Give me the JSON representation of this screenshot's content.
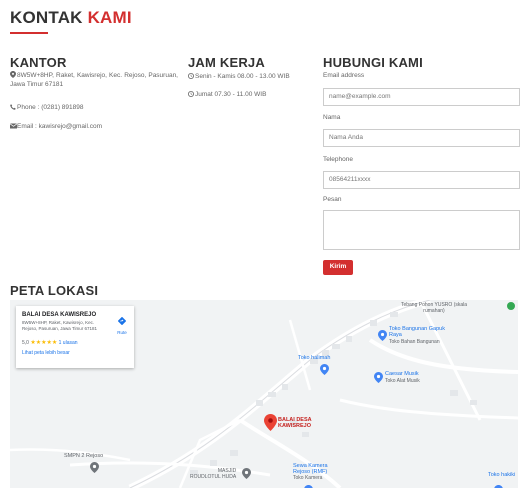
{
  "header": {
    "title_main": "KONTAK ",
    "title_accent": "KAMI"
  },
  "kantor": {
    "heading": "KANTOR",
    "address": "8W5W+8HP, Raket, Kawisrejo, Kec. Rejoso, Pasuruan, Jawa Timur 67181",
    "phone": "Phone : (0281) 891898",
    "email": "Email : kawisrejo@gmail.com"
  },
  "jam_kerja": {
    "heading": "JAM KERJA",
    "line1": "Senin - Kamis 08.00 - 13.00 WIB",
    "line2": "Jumat 07.30 - 11.00 WIB"
  },
  "hubungi": {
    "heading": "HUBUNGI KAMI",
    "email_label": "Email address",
    "email_placeholder": "name@example.com",
    "nama_label": "Nama",
    "nama_placeholder": "Nama Anda",
    "phone_label": "Telephone",
    "phone_placeholder": "08564211xxxx",
    "pesan_label": "Pesan",
    "submit": "Kirim"
  },
  "peta": {
    "heading": "PETA LOKASI",
    "card_title": "BALAI DESA KAWISREJO",
    "card_address": "8W5W+8HP, Raket, Kawisrejo, Kec. Rejoso, Pasuruan, Jawa Timur 67181",
    "rating": "5,0",
    "reviews": "1 ulasan",
    "larger_map": "Lihat peta lebih besar",
    "route": "Rute",
    "places": {
      "tebang": "Tebang Pohon YUSRO (skala rumahan)",
      "toko_bangunan": "Toko Bangunan Gapuk Raya",
      "toko_bangunan_sub": "Toko Bahan Bangunan",
      "toko_halimah": "Toko halimah",
      "caesar": "Caesar Musik",
      "caesar_sub": "Toko Alat Musik",
      "balai_line1": "BALAI DESA",
      "balai_line2": "KAWISREJO",
      "smpn": "SMPN 2 Rejoso",
      "masjid_line1": "MASJID",
      "masjid_line2": "ROUDLOTUL HUDA",
      "sewa_line1": "Sewa Kamera",
      "sewa_line2": "Rejoso (RMF)",
      "sewa_sub": "Toko Kamera",
      "toko_hakiki": "Toko hakiki"
    }
  },
  "colors": {
    "accent": "#d32f2f",
    "map_bg": "#f1f3f4",
    "map_pin_blue": "#4285f4"
  }
}
